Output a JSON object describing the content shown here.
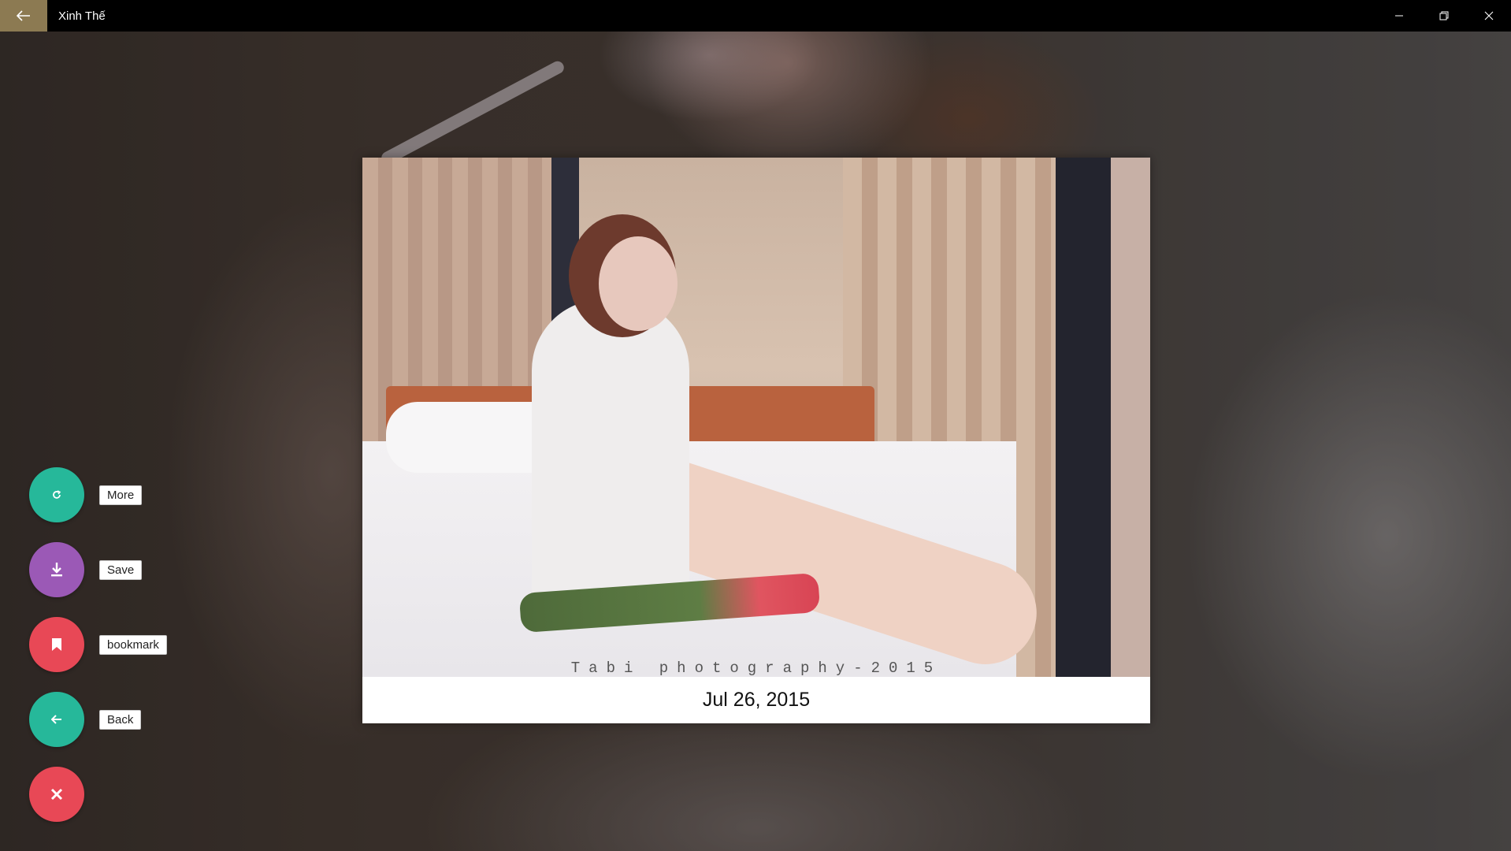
{
  "window": {
    "title": "Xinh Thế",
    "back_icon": "arrow-left-icon",
    "controls": [
      "minimize-icon",
      "restore-icon",
      "close-icon"
    ]
  },
  "photo": {
    "watermark": "Tabi photography-2015",
    "date": "Jul 26, 2015"
  },
  "actions": [
    {
      "label": "More",
      "icon": "refresh-icon",
      "color": "#26b89a"
    },
    {
      "label": "Save",
      "icon": "download-icon",
      "color": "#9b59b6"
    },
    {
      "label": "bookmark",
      "icon": "bookmark-icon",
      "color": "#e84856"
    },
    {
      "label": "Back",
      "icon": "arrow-left-icon",
      "color": "#26b89a"
    },
    {
      "label": "",
      "icon": "close-icon",
      "color": "#e84856"
    }
  ]
}
